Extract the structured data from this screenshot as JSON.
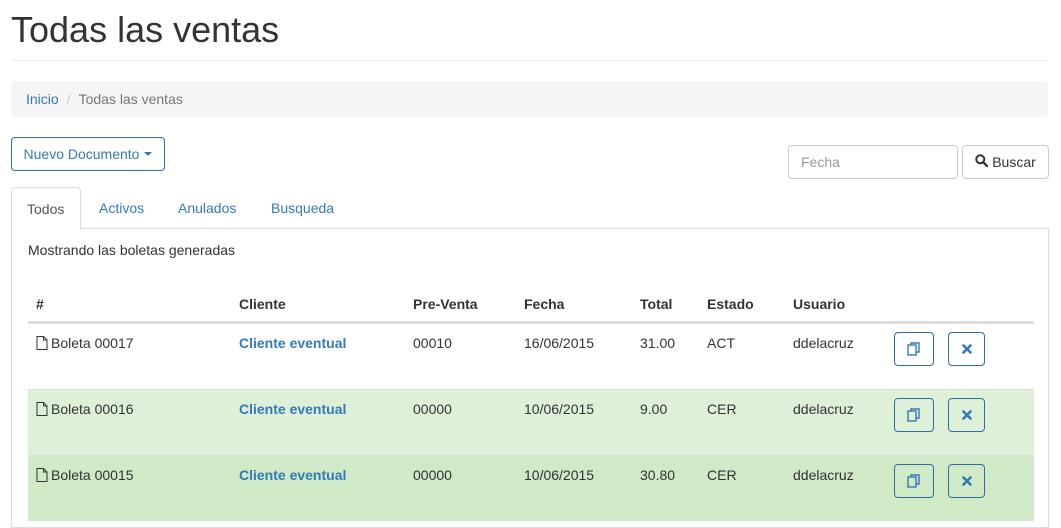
{
  "page": {
    "title": "Todas las ventas"
  },
  "breadcrumb": {
    "home": "Inicio",
    "separator": "/",
    "current": "Todas las ventas"
  },
  "toolbar": {
    "new_document_label": "Nuevo Documento",
    "date_placeholder": "Fecha",
    "search_label": "Buscar"
  },
  "tabs": [
    {
      "label": "Todos",
      "active": true
    },
    {
      "label": "Activos",
      "active": false
    },
    {
      "label": "Anulados",
      "active": false
    },
    {
      "label": "Busqueda",
      "active": false
    }
  ],
  "panel": {
    "message": "Mostrando las boletas generadas"
  },
  "table": {
    "headers": [
      "#",
      "Cliente",
      "Pre-Venta",
      "Fecha",
      "Total",
      "Estado",
      "Usuario"
    ],
    "rows": [
      {
        "doc": "Boleta 00017",
        "client": "Cliente eventual",
        "preventa": "00010",
        "date": "16/06/2015",
        "total": "31.00",
        "status": "ACT",
        "user": "ddelacruz"
      },
      {
        "doc": "Boleta 00016",
        "client": "Cliente eventual",
        "preventa": "00000",
        "date": "10/06/2015",
        "total": "9.00",
        "status": "CER",
        "user": "ddelacruz"
      },
      {
        "doc": "Boleta 00015",
        "client": "Cliente eventual",
        "preventa": "00000",
        "date": "10/06/2015",
        "total": "30.80",
        "status": "CER",
        "user": "ddelacruz"
      }
    ]
  },
  "icons": {
    "document": "file-icon",
    "copy": "copy-icon",
    "delete": "close-icon",
    "search": "search-icon"
  },
  "colors": {
    "link": "#337ab7",
    "success_row": "#dff0d8",
    "success_row_alt": "#d0e9c6"
  }
}
